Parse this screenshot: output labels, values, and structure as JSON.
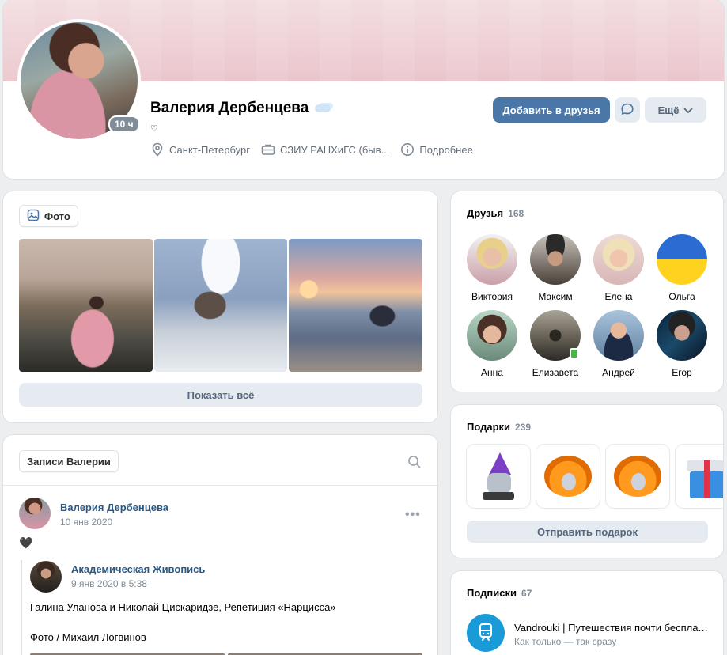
{
  "profile": {
    "name": "Валерия Дербенцева",
    "online": "10 ч",
    "status": "♡",
    "city": "Санкт-Петербург",
    "education": "СЗИУ РАНХиГС (быв...",
    "details": "Подробнее",
    "add_friend": "Добавить в друзья",
    "more": "Ещё"
  },
  "photos": {
    "tab_label": "Фото",
    "show_all": "Показать всё"
  },
  "wall": {
    "tab_label": "Записи Валерии",
    "post": {
      "author": "Валерия Дербенцева",
      "date": "10 янв 2020",
      "text": "🖤",
      "repost": {
        "author": "Академическая Живопись",
        "date": "9 янв 2020 в 5:38",
        "text1": "Галина Уланова и Николай Цискаридзе, Репетиция «Нарцисса»",
        "text2": "Фото / Михаил Логвинов"
      }
    }
  },
  "friends": {
    "title": "Друзья",
    "count": "168",
    "items": [
      {
        "name": "Виктория"
      },
      {
        "name": "Максим"
      },
      {
        "name": "Елена"
      },
      {
        "name": "Ольга"
      },
      {
        "name": "Анна"
      },
      {
        "name": "Елизавета"
      },
      {
        "name": "Андрей"
      },
      {
        "name": "Егор"
      }
    ]
  },
  "gifts": {
    "title": "Подарки",
    "count": "239",
    "send": "Отправить подарок"
  },
  "subscriptions": {
    "title": "Подписки",
    "count": "67",
    "items": [
      {
        "name": "Vandrouki | Путешествия почти бесплатно",
        "desc": "Как только — так сразу"
      }
    ]
  },
  "colors": {
    "accent": "#4a76a8",
    "link": "#2a5885",
    "secondary_button": "#e5ebf1",
    "background": "#edeef0"
  }
}
